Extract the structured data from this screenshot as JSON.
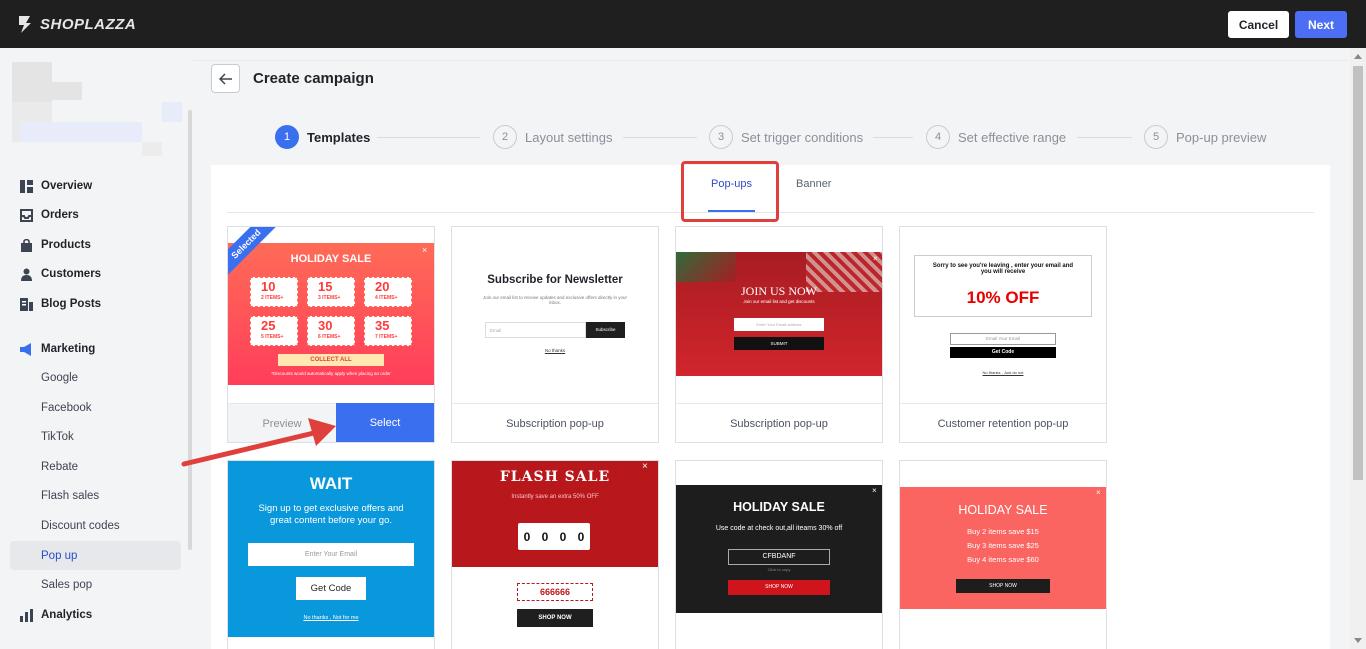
{
  "header": {
    "brand": "SHOPLAZZA",
    "cancel_label": "Cancel",
    "next_label": "Next"
  },
  "sidebar": {
    "items": [
      {
        "label": "Overview",
        "icon": "overview-icon"
      },
      {
        "label": "Orders",
        "icon": "orders-icon"
      },
      {
        "label": "Products",
        "icon": "products-icon"
      },
      {
        "label": "Customers",
        "icon": "customers-icon"
      },
      {
        "label": "Blog Posts",
        "icon": "blog-icon"
      },
      {
        "label": "Marketing",
        "icon": "marketing-icon"
      }
    ],
    "marketing_sub": [
      "Google",
      "Facebook",
      "TikTok",
      "Rebate",
      "Flash sales",
      "Discount codes",
      "Pop up",
      "Sales pop"
    ],
    "active_sub": "Pop up",
    "analytics_label": "Analytics"
  },
  "page": {
    "title": "Create campaign"
  },
  "steps": [
    {
      "num": "1",
      "label": "Templates",
      "active": true
    },
    {
      "num": "2",
      "label": "Layout settings",
      "active": false
    },
    {
      "num": "3",
      "label": "Set trigger conditions",
      "active": false
    },
    {
      "num": "4",
      "label": "Set effective range",
      "active": false
    },
    {
      "num": "5",
      "label": "Pop-up preview",
      "active": false
    }
  ],
  "tabs": [
    {
      "label": "Pop-ups",
      "active": true
    },
    {
      "label": "Banner",
      "active": false
    }
  ],
  "templates": {
    "card1": {
      "selected_badge": "Selected",
      "title": "HOLIDAY SALE",
      "coupons": [
        {
          "value": "10",
          "sub": "2 ITEMS+"
        },
        {
          "value": "15",
          "sub": "3 ITEMS+"
        },
        {
          "value": "20",
          "sub": "4 ITEMS+"
        },
        {
          "value": "25",
          "sub": "5 ITEMS+"
        },
        {
          "value": "30",
          "sub": "6 ITEMS+"
        },
        {
          "value": "35",
          "sub": "7 ITEMS+"
        }
      ],
      "cta": "COLLECT ALL",
      "note": "*Discounts would automatically apply when placing an order",
      "preview_label": "Preview",
      "select_label": "Select"
    },
    "card2": {
      "heading": "Subscribe for Newsletter",
      "text": "Join our email list to receive updates and exclusive offers directly in your inbox.",
      "email_placeholder": "Email",
      "button": "Subscribe",
      "dismiss": "No thanks",
      "caption": "Subscription pop-up"
    },
    "card3": {
      "heading": "JOIN US NOW",
      "text": "Join our email list and get discounts",
      "email_placeholder": "Enter Your Email address",
      "button": "SUBMIT",
      "caption": "Subscription pop-up"
    },
    "card4": {
      "heading": "Sorry to see you're leaving , enter your email and you will receive",
      "offer": "10% OFF",
      "email_placeholder": "Email Your Email",
      "button": "Get Code",
      "dismiss": "No thanks , Just do not",
      "caption": "Customer retention pop-up"
    },
    "card5": {
      "heading": "WAIT",
      "text": "Sign up to get exclusive offers and great content before your go.",
      "email_placeholder": "Enter Your Email",
      "button": "Get Code",
      "dismiss": "No thanks , Not for me"
    },
    "card6": {
      "heading": "FLASH SALE",
      "text": "Instantly save an extra 50% OFF",
      "timer": [
        "0",
        "0",
        "0",
        "0"
      ],
      "code": "666666",
      "button": "SHOP NOW"
    },
    "card7": {
      "heading": "HOLIDAY SALE",
      "text": "Use code at check out,all iteams 30% off",
      "code": "CFBDANF",
      "copy_hint": "Click to copy",
      "button": "SHOP NOW"
    },
    "card8": {
      "heading": "HOLIDAY SALE",
      "lines": [
        "Buy 2 items save $15",
        "Buy 3 items save $25",
        "Buy 4 items save $60"
      ],
      "button": "SHOP NOW"
    }
  },
  "colors": {
    "accent": "#3a70f0",
    "highlight": "#e0403c",
    "topbar": "#1f1f1f"
  }
}
